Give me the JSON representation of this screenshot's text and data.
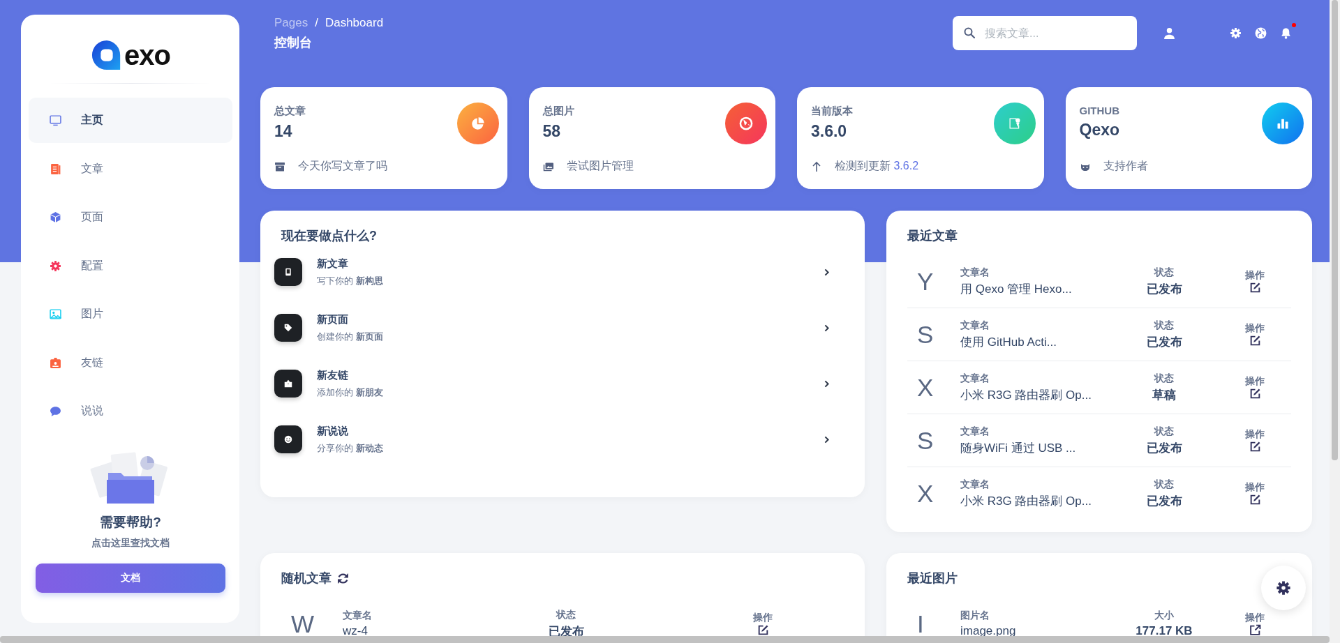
{
  "sidebar": {
    "logo": "exo",
    "items": [
      {
        "label": "主页",
        "selected": true
      },
      {
        "label": "文章",
        "selected": false
      },
      {
        "label": "页面",
        "selected": false
      },
      {
        "label": "配置",
        "selected": false
      },
      {
        "label": "图片",
        "selected": false
      },
      {
        "label": "友链",
        "selected": false
      },
      {
        "label": "说说",
        "selected": false
      }
    ],
    "help": {
      "title": "需要帮助?",
      "subtitle": "点击这里查找文档",
      "button": "文档"
    }
  },
  "header": {
    "breadcrumb": [
      "Pages",
      "Dashboard"
    ],
    "separator": "/",
    "title": "控制台",
    "search": {
      "placeholder": "搜索文章..."
    },
    "notification": true
  },
  "stats": [
    {
      "title": "总文章",
      "value": "14",
      "footer": "今天你写文章了吗"
    },
    {
      "title": "总图片",
      "value": "58",
      "footer": "尝试图片管理"
    },
    {
      "title": "当前版本",
      "value": "3.6.0",
      "footer": "检测到更新",
      "footer_link": "3.6.2"
    },
    {
      "title": "GITHUB",
      "value": "Qexo",
      "footer": "支持作者"
    }
  ],
  "quick_actions": {
    "title": "现在要做点什么?",
    "items": [
      {
        "title": "新文章",
        "subtitle": "写下你的 **新构思**"
      },
      {
        "title": "新页面",
        "subtitle": "创建你的 **新页面**"
      },
      {
        "title": "新友链",
        "subtitle": "添加你的 **新朋友**"
      },
      {
        "title": "新说说",
        "subtitle": "分享你的 **新动态**"
      }
    ]
  },
  "recent_posts": {
    "title": "最近文章",
    "rows": [
      {
        "initial": "Y",
        "name_label": "文章名",
        "name": "用 Qexo 管理 Hexo...",
        "status_label": "状态",
        "status": "已发布",
        "action_label": "操作"
      },
      {
        "initial": "S",
        "name_label": "文章名",
        "name": "使用 GitHub Acti...",
        "status_label": "状态",
        "status": "已发布",
        "action_label": "操作"
      },
      {
        "initial": "X",
        "name_label": "文章名",
        "name": "小米 R3G 路由器刷 Op...",
        "status_label": "状态",
        "status": "草稿",
        "action_label": "操作"
      },
      {
        "initial": "S",
        "name_label": "文章名",
        "name": "随身WiFi 通过 USB ...",
        "status_label": "状态",
        "status": "已发布",
        "action_label": "操作"
      },
      {
        "initial": "X",
        "name_label": "文章名",
        "name": "小米 R3G 路由器刷 Op...",
        "status_label": "状态",
        "status": "已发布",
        "action_label": "操作"
      }
    ]
  },
  "random_posts": {
    "title": "随机文章",
    "rows": [
      {
        "initial": "W",
        "name_label": "文章名",
        "name": "wz-4",
        "status_label": "状态",
        "status": "已发布",
        "action_label": "操作"
      }
    ]
  },
  "recent_images": {
    "title": "最近图片",
    "rows": [
      {
        "initial": "I",
        "name_label": "图片名",
        "name": "image.png",
        "status_label": "大小",
        "status": "177.17 KB",
        "action_label": "操作"
      }
    ]
  }
}
